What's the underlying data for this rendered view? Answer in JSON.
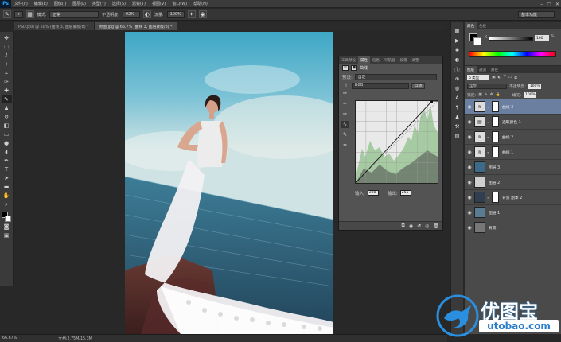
{
  "app": {
    "logo": "Ps"
  },
  "menu": [
    "文件(F)",
    "编辑(E)",
    "图像(I)",
    "图层(L)",
    "类型(Y)",
    "选择(S)",
    "滤镜(T)",
    "视图(V)",
    "窗口(W)",
    "帮助(H)"
  ],
  "window_controls": [
    "–",
    "□",
    "✕"
  ],
  "options": {
    "mode_label": "模式:",
    "mode_value": "正常",
    "opacity_label": "不透明度:",
    "opacity_value": "92%",
    "flow_label": "流量:",
    "flow_value": "100%",
    "workspace": "基本功能"
  },
  "tabs": [
    {
      "label": "PSD.psd @ 50% (曲线 3, 图层蒙版/8) *"
    },
    {
      "label": "原图.jpg @ 66.7% (曲线 3, 图层蒙版/8) *"
    }
  ],
  "status": {
    "zoom": "66.67%",
    "doc": "文档:2.75M/15.3M"
  },
  "properties": {
    "tabs": [
      "工具预设",
      "属性",
      "信息",
      "导航器",
      "段落",
      "调整"
    ],
    "active_tab": "属性",
    "title": "曲线",
    "preset_label": "预设:",
    "preset_value": "自定",
    "channel_value": "RGB",
    "auto_label": "自动",
    "input_label": "输入:",
    "input_value": "238",
    "output_label": "输出:",
    "output_value": "255"
  },
  "color_panel": {
    "tabs": [
      "颜色",
      "色板"
    ],
    "channel_label": "K",
    "value": "100",
    "unit": "%"
  },
  "layers_panel": {
    "tabs": [
      "图层",
      "通道",
      "路径"
    ],
    "kind_label": "ρ 类型",
    "blend_mode": "正常",
    "opacity_label": "不透明度:",
    "opacity_value": "100%",
    "lock_label": "锁定:",
    "fill_label": "填充:",
    "fill_value": "100%",
    "layers": [
      {
        "name": "曲线 3",
        "thumb": "≋",
        "mask": true,
        "selected": true
      },
      {
        "name": "选取颜色 1",
        "thumb": "▤",
        "mask": true,
        "selected": false
      },
      {
        "name": "曲线 2",
        "thumb": "≋",
        "mask": true,
        "selected": false
      },
      {
        "name": "曲线 1",
        "thumb": "≋",
        "mask": true,
        "selected": false
      },
      {
        "name": "图层 3",
        "thumb": "",
        "mask": false,
        "selected": false
      },
      {
        "name": "图层 2",
        "thumb": "",
        "mask": false,
        "selected": false
      },
      {
        "name": "背景 副本 2",
        "thumb": "",
        "mask": true,
        "selected": false
      },
      {
        "name": "图层 1",
        "thumb": "",
        "mask": false,
        "selected": false
      },
      {
        "name": "背景",
        "thumb": "",
        "mask": false,
        "selected": false
      }
    ]
  },
  "watermark": {
    "title": "优图宝",
    "url": "utobao.com"
  }
}
